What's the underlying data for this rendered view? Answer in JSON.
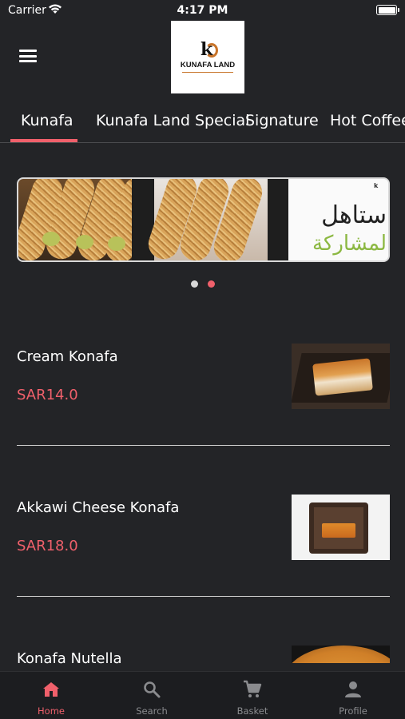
{
  "status_bar": {
    "carrier": "Carrier",
    "time": "4:17 PM"
  },
  "header": {
    "logo_text": "KUNAFA LAND"
  },
  "tabs": [
    {
      "label": "Kunafa",
      "active": true
    },
    {
      "label": "Kunafa Land Special",
      "active": false
    },
    {
      "label": "Signature",
      "active": false
    },
    {
      "label": "Hot Coffee",
      "active": false
    }
  ],
  "banner": {
    "arabic_line_1": "ستاهل",
    "arabic_line_2": "لمشاركة",
    "slide_count": 2,
    "active_slide": 2
  },
  "menu_items": [
    {
      "name": "Cream Konafa",
      "price": "SAR14.0"
    },
    {
      "name": "Akkawi Cheese Konafa",
      "price": "SAR18.0"
    },
    {
      "name": "Konafa Nutella",
      "price": ""
    }
  ],
  "bottom_nav": [
    {
      "label": "Home",
      "icon": "home-icon",
      "active": true
    },
    {
      "label": "Search",
      "icon": "search-icon",
      "active": false
    },
    {
      "label": "Basket",
      "icon": "cart-icon",
      "active": false
    },
    {
      "label": "Profile",
      "icon": "profile-icon",
      "active": false
    }
  ],
  "colors": {
    "background": "#232427",
    "accent": "#f0606b",
    "nav_inactive": "#8a8b8e",
    "dot_inactive": "#d8d8d8"
  }
}
